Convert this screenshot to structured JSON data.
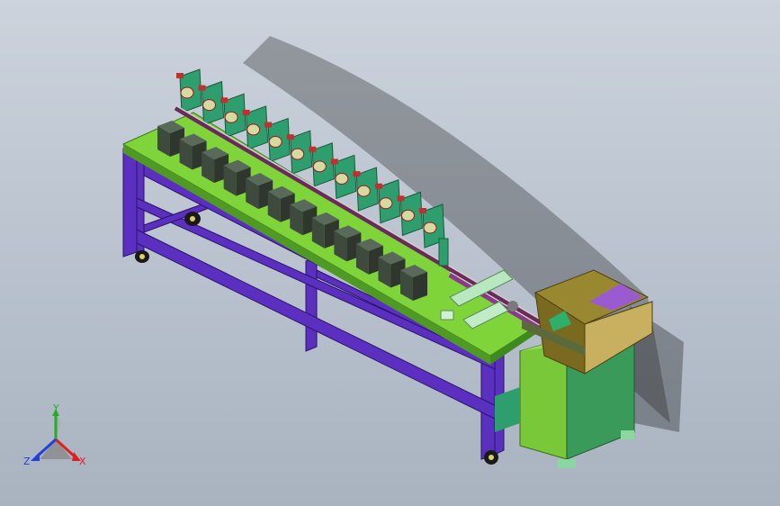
{
  "viewport": {
    "background_top": "#ccd3dd",
    "background_bottom": "#a9b3c0"
  },
  "model": {
    "frame_color": "#5b2fc0",
    "tabletop_color": "#7fd43a",
    "station_color": "#2f9e6e",
    "box_color": "#3f4a3f",
    "hopper_color": "#8a7a2a",
    "cabinet_color": "#78c83a",
    "station_count": 12
  },
  "triad": {
    "x_label": "X",
    "y_label": "Y",
    "z_label": "Z",
    "x_color": "#e02020",
    "y_color": "#20b020",
    "z_color": "#2040e0"
  }
}
